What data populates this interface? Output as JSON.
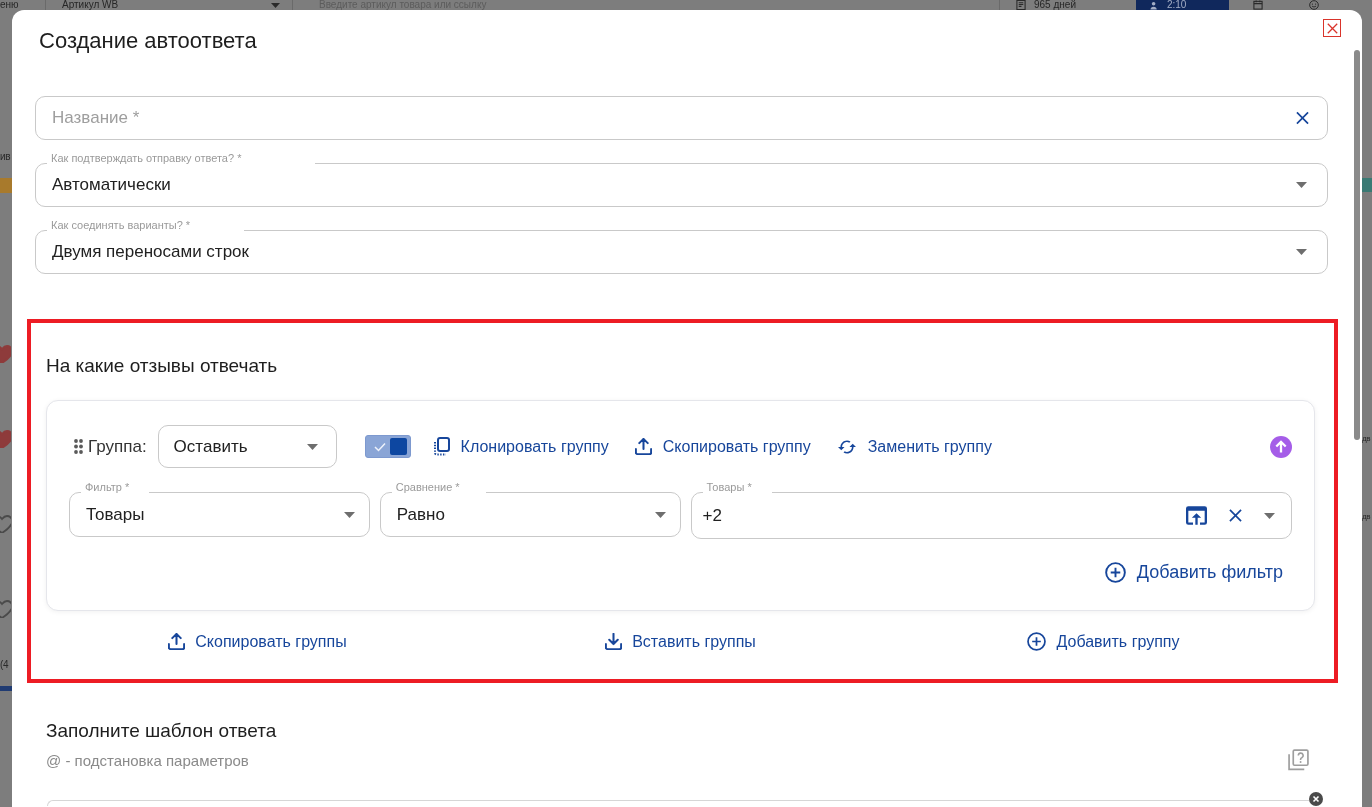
{
  "background_app": {
    "top_bar": {
      "menu_label": "еню",
      "article_select": "Артикул WB",
      "search": {
        "placeholder": "Введите артикул товара или ссылку"
      },
      "days": "965 дней",
      "timer": "2:10"
    },
    "left_edge": [
      "ив",
      "(4"
    ],
    "right_edge": [
      "дв",
      "дв"
    ]
  },
  "dialog": {
    "title": "Создание автоответа",
    "fields": [
      {
        "kind": "text",
        "placeholder": "Название *"
      },
      {
        "kind": "select",
        "label": "Как подтверждать отправку ответа? *",
        "value": "Автоматически"
      },
      {
        "kind": "select",
        "label": "Как соединять варианты? *",
        "value": "Двумя переносами строк"
      }
    ],
    "rules_section": {
      "title": "На какие отзывы отвечать",
      "highlighted": true,
      "groups": [
        {
          "label": "Группа:",
          "mode": "Оставить",
          "enabled": true,
          "actions": [
            {
              "kind": "clone",
              "label": "Клонировать группу"
            },
            {
              "kind": "copy",
              "label": "Скопировать группу"
            },
            {
              "kind": "replace",
              "label": "Заменить группу"
            }
          ],
          "filters": [
            {
              "kind": "select",
              "label": "Фильтр *",
              "value": "Товары"
            },
            {
              "kind": "select",
              "label": "Сравнение *",
              "value": "Равно"
            },
            {
              "kind": "multi",
              "label": "Товары *",
              "value": "+2"
            }
          ],
          "add_filter": "Добавить фильтр"
        }
      ],
      "footer_actions": [
        {
          "kind": "copy",
          "label": "Скопировать группы"
        },
        {
          "kind": "paste",
          "label": "Вставить группы"
        },
        {
          "kind": "add",
          "label": "Добавить группу"
        }
      ]
    },
    "template_section": {
      "title": "Заполните шаблон ответа",
      "hint": "@ - подстановка параметров"
    }
  }
}
